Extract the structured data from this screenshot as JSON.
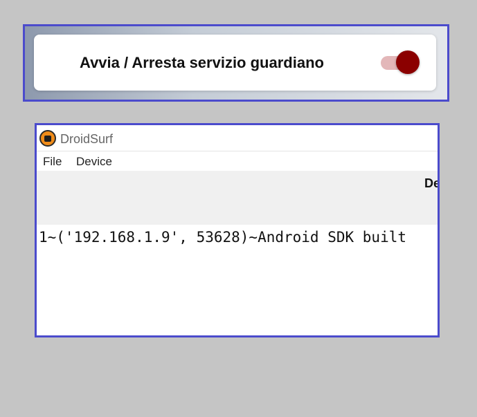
{
  "toggle_card": {
    "label": "Avvia / Arresta servizio guardiano",
    "toggle_state": "on",
    "accent_color": "#8b0000"
  },
  "window": {
    "title": "DroidSurf",
    "app_icon": "droidsurf-logo-icon",
    "menu": [
      {
        "label": "File"
      },
      {
        "label": "Device"
      }
    ],
    "column_header_partial": "De",
    "rows": [
      "1~('192.168.1.9', 53628)~Android SDK built"
    ]
  }
}
